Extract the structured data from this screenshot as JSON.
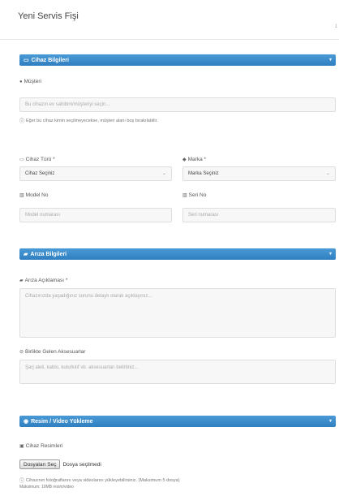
{
  "page": {
    "title": "Yeni Servis Fişi",
    "corner_mark": "1"
  },
  "device_section": {
    "header": "Cihaz Bilgileri",
    "header_icon": "laptop-icon",
    "customer_label": "Müşteri",
    "customer_placeholder": "Bu cihazın ev sahibini/müşteriyi seçin...",
    "customer_help": "Eğer bu cihaz kimin seçilmeyecekse, müşteri alanı boş bırakılabilir.",
    "type_label": "Cihaz Türü *",
    "type_value": "Cihaz Seçiniz",
    "brand_label": "Marka *",
    "brand_value": "Marka Seçiniz",
    "model_label": "Model No",
    "model_placeholder": "Model numarası",
    "serial_label": "Seri No",
    "serial_placeholder": "Seri numarası"
  },
  "fault_section": {
    "header": "Arıza Bilgileri",
    "header_icon": "comment-icon",
    "description_label": "Arıza Açıklaması *",
    "description_placeholder": "Cihazınızda yaşadığınız sorunu detaylı olarak açıklayınız...",
    "accessories_label": "Birlikte Gelen Aksesuarlar",
    "accessories_placeholder": "Şarj aleti, kablo, kutu/kılıf vb. aksesuarları belirtiniz..."
  },
  "upload_section": {
    "header": "Resim / Video Yükleme",
    "header_icon": "camera-icon",
    "photos_label": "Cihaz Resimleri",
    "choose_button": "Dosyaları Seç",
    "file_status": "Dosya seçilmedi",
    "help_line1": "Cihazının fotoğraflarını veya videolarını yükleyebilirsiniz. (Maksimum 5 dosya)",
    "help_line2": "Maksimum: 10MB resim/video"
  },
  "colors": {
    "header_blue": "#2f7fc1",
    "field_bg": "#f7f7f7",
    "field_border": "#dedede"
  }
}
